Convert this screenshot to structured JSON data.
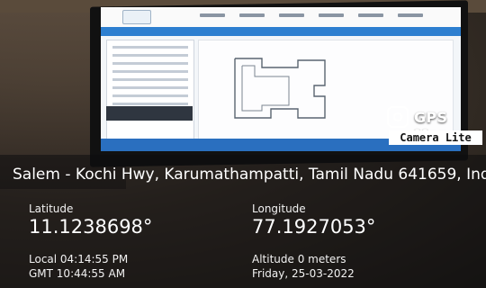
{
  "app": {
    "title": "GPS Map",
    "subtitle": "Camera Lite"
  },
  "location": {
    "address": "Salem - Kochi Hwy, Karumathampatti, Tamil Nadu 641659, India",
    "latitude_label": "Latitude",
    "latitude_value": "11.1238698°",
    "longitude_label": "Longitude",
    "longitude_value": "77.1927053°",
    "local_time": "Local 04:14:55 PM",
    "gmt_time": "GMT 10:44:55 AM",
    "altitude": "Altitude 0 meters",
    "date": "Friday, 25-03-2022"
  }
}
